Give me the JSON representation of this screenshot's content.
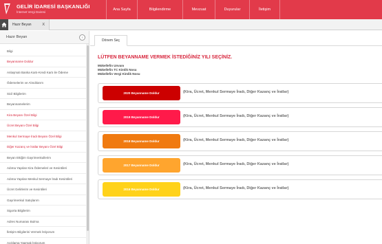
{
  "brand": {
    "title": "GELİR İDARESİ BAŞKANLIĞI",
    "subtitle": "İnternet Vergi Dairesi"
  },
  "nav": [
    "Ana Sayfa",
    "Bilgilendirme",
    "Mevzuat",
    "Duyurular",
    "İletişim"
  ],
  "tabs": {
    "active": "Hazır Beyan",
    "close": "X"
  },
  "sidebar": {
    "title": "Hazır Beyan",
    "toggle": "‹",
    "items": [
      {
        "label": "Bilgi",
        "color": "#555555"
      },
      {
        "label": "Beyanname Doldur",
        "color": "#d7263d"
      },
      {
        "label": "Anlaşmalı Banka Kartı-Kredi Kartı ile Ödeme",
        "color": "#555555"
      },
      {
        "label": "Ödemelerim ve Alındılarım",
        "color": "#555555"
      },
      {
        "label": "Sicil Bilgilerim",
        "color": "#555555"
      },
      {
        "label": "Beyannamelerim",
        "color": "#555555"
      },
      {
        "label": "Kira Beyanı Özel Bilgi",
        "color": "#d7263d"
      },
      {
        "label": "Ücret Beyanı Özel Bilgi",
        "color": "#d7263d"
      },
      {
        "label": "Menkul Sermaye İradı Beyanı Özel Bilgi",
        "color": "#d7263d"
      },
      {
        "label": "Diğer Kazanç ve İratlar Beyanı Özel Bilgi",
        "color": "#d7263d"
      },
      {
        "label": "Beyan Ettiğim Gayrimenkullerim",
        "color": "#555555"
      },
      {
        "label": "Adıma Yapılan Kira Ödemeleri ve Kesintileri",
        "color": "#555555"
      },
      {
        "label": "Adıma Yapılan Menkul Sermaye İradı Kesintileri",
        "color": "#555555"
      },
      {
        "label": "Ücret Gelirlerim ve Kesintileri",
        "color": "#555555"
      },
      {
        "label": "Gayrimenkul Satışlarım",
        "color": "#555555"
      },
      {
        "label": "Sigorta Bilgilerim",
        "color": "#555555"
      },
      {
        "label": "Adres Numarası Bulma",
        "color": "#555555"
      },
      {
        "label": "İletişim Bilgilerini Vermek İstiyorum",
        "color": "#555555"
      },
      {
        "label": "Açıklama Yapmak İstiyorum",
        "color": "#555555"
      }
    ]
  },
  "main": {
    "tab": "Dönem Seç",
    "heading": "LÜTFEN BEYANNAME VERMEK İSTEDİĞİNİZ YILI SEÇİNİZ.",
    "info": [
      "Mükellefin Unvanı",
      "Mükellefin TC Kimlik Nosu",
      "Mükellefin Vergi Kimlik Nosu"
    ],
    "rows": [
      {
        "button": "2020 Beyanname Doldur",
        "color": "#cc0000",
        "desc": "(Kira, Ücret, Menkul Sermaye İradı, Diğer Kazanç ve İratlar)"
      },
      {
        "button": "2019 Beyanname Doldur",
        "color": "#ff1a4a",
        "desc": "(Kira, Ücret, Menkul Sermaye İradı, Diğer Kazanç ve İratlar)"
      },
      {
        "button": "2018 Beyanname Doldur",
        "color": "#f07a10",
        "desc": "(Kira, Ücret, Menkul Sermaye İradı, Diğer Kazanç ve İratlar)"
      },
      {
        "button": "2017 Beyanname Doldur",
        "color": "#ffa52e",
        "desc": "(Kira, Ücret, Menkul Sermaye İradı, Diğer Kazanç ve İratlar)"
      },
      {
        "button": "2016 Beyanname Doldur",
        "color": "#ffd21a",
        "desc": "(Kira, Ücret, Menkul Sermaye İradı, Diğer Kazanç ve İratlar)"
      }
    ]
  }
}
